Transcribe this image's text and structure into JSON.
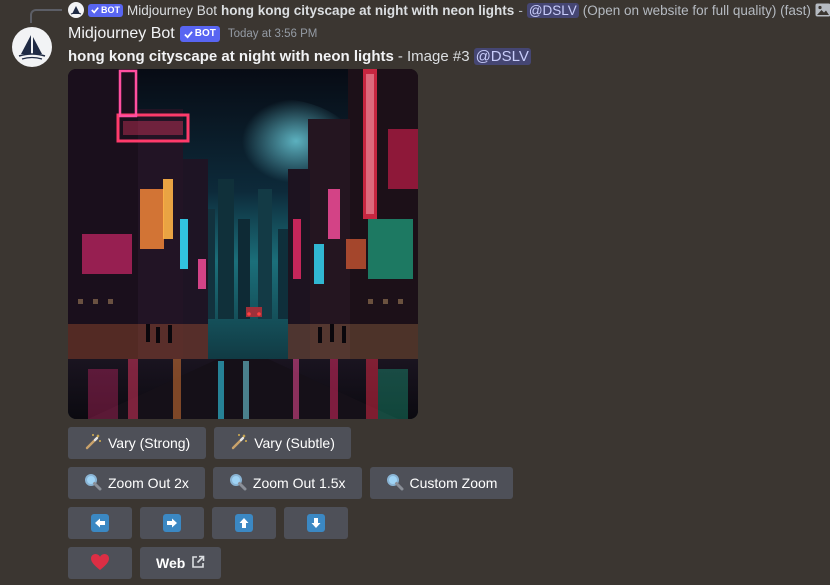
{
  "reply": {
    "author": "Midjourney Bot",
    "bot_tag": "BOT",
    "prompt": "hong kong cityscape at night with neon lights",
    "separator": " - ",
    "mention": "@DSLV",
    "suffix": "(Open on website for full quality) (fast)"
  },
  "message": {
    "author": "Midjourney Bot",
    "bot_tag": "BOT",
    "timestamp": "Today at 3:56 PM",
    "prompt": "hong kong cityscape at night with neon lights",
    "image_label": "- Image #3",
    "mention": "@DSLV"
  },
  "buttons": {
    "vary_strong": "Vary (Strong)",
    "vary_subtle": "Vary (Subtle)",
    "zoom_out_2x": "Zoom Out 2x",
    "zoom_out_1_5x": "Zoom Out 1.5x",
    "custom_zoom": "Custom Zoom",
    "web": "Web"
  },
  "icons": {
    "vary": "magic-wand-icon",
    "zoom": "magnifier-icon",
    "pan_left": "arrow-left-icon",
    "pan_right": "arrow-right-icon",
    "pan_up": "arrow-up-icon",
    "pan_down": "arrow-down-icon",
    "favorite": "heart-icon",
    "external": "external-link-icon"
  },
  "colors": {
    "background": "#3b3631",
    "button": "#4e5058",
    "blurple": "#5865f2",
    "arrow_blue": "#3b88c3",
    "heart": "#dd2e44"
  }
}
